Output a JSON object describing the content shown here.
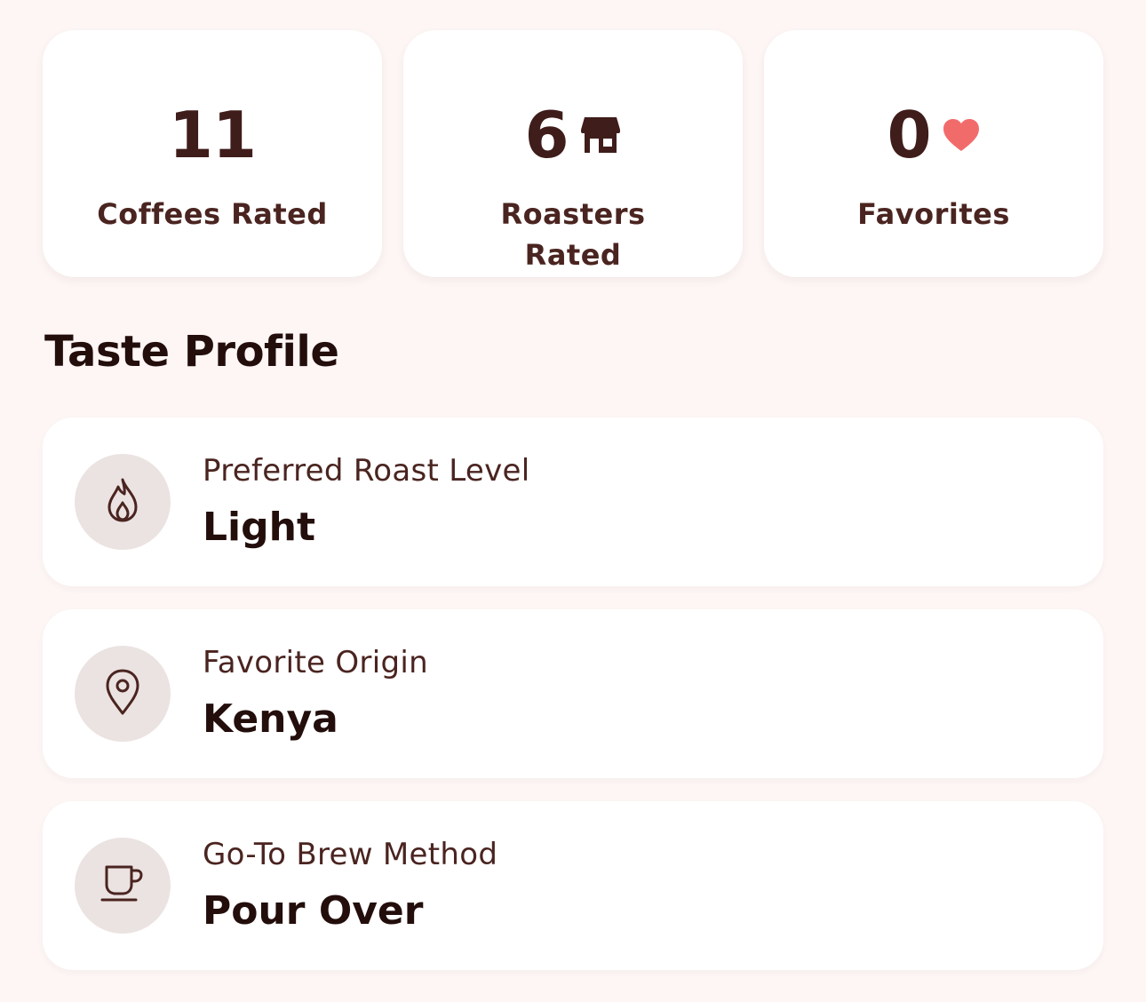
{
  "stats": [
    {
      "value": "11",
      "label": "Coffees Rated",
      "icon": null
    },
    {
      "value": "6",
      "label": "Roasters Rated",
      "icon": "storefront-icon"
    },
    {
      "value": "0",
      "label": "Favorites",
      "icon": "heart-icon"
    }
  ],
  "taste_profile": {
    "title": "Taste Profile",
    "items": [
      {
        "label": "Preferred Roast Level",
        "value": "Light",
        "icon": "flame-icon"
      },
      {
        "label": "Favorite Origin",
        "value": "Kenya",
        "icon": "location-pin-icon"
      },
      {
        "label": "Go-To Brew Method",
        "value": "Pour Over",
        "icon": "coffee-cup-icon"
      }
    ]
  },
  "colors": {
    "background": "#fdf6f5",
    "card": "#ffffff",
    "primary_text": "#3f1d1a",
    "heart": "#f26b6b",
    "icon_circle": "#ebe3e2"
  }
}
